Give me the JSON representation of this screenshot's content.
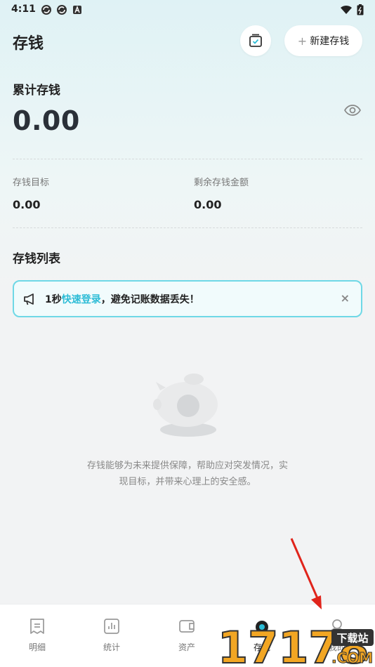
{
  "status": {
    "time": "4:11",
    "icons": [
      "sync-icon",
      "sync-icon",
      "app-a-icon"
    ],
    "right_icons": [
      "wifi-icon",
      "battery-icon"
    ]
  },
  "header": {
    "title": "存钱",
    "new_button_label": "新建存钱"
  },
  "summary": {
    "total_label": "累计存钱",
    "total_value": "0.00",
    "goal_label": "存钱目标",
    "goal_value": "0.00",
    "remaining_label": "剩余存钱金额",
    "remaining_value": "0.00"
  },
  "list": {
    "title": "存钱列表",
    "banner": {
      "prefix": "1秒",
      "link": "快速登录",
      "suffix": "，避免记账数据丢失！",
      "close": "×"
    },
    "empty_text": "存钱能够为未来提供保障，帮助应对突发情况，实现目标，并带来心理上的安全感。"
  },
  "tabs": [
    {
      "label": "明细",
      "icon": "list-icon"
    },
    {
      "label": "统计",
      "icon": "chart-icon"
    },
    {
      "label": "资产",
      "icon": "wallet-icon"
    },
    {
      "label": "存钱",
      "icon": "piggy-icon"
    },
    {
      "label": "我的",
      "icon": "user-icon"
    }
  ],
  "watermark": {
    "text": "17178",
    "sub": "下载站",
    "domain": ".COM"
  },
  "colors": {
    "accent": "#2cbcd6",
    "banner_border": "#6fd8e6",
    "arrow": "#e0241b"
  }
}
